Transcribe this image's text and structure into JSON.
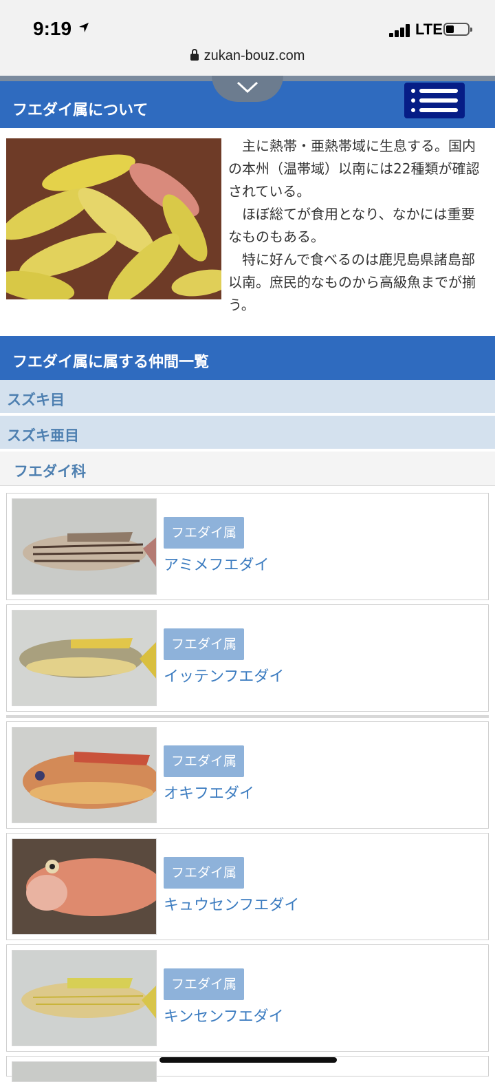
{
  "status_bar": {
    "time": "9:19",
    "network": "LTE",
    "url": "zukan-bouz.com"
  },
  "header": {
    "title": "フエダイ属について"
  },
  "intro": {
    "paragraphs": [
      "主に熱帯・亜熱帯域に生息する。国内の本州（温帯域）以南には22種類が確認されている。",
      "ほぼ総てが食用となり、なかには重要なものもある。",
      "特に好んで食べるのは鹿児島県諸島部以南。庶民的なものから高級魚までが揃う。"
    ]
  },
  "list_header": {
    "title": "フエダイ属に属する仲間一覧"
  },
  "taxonomy": {
    "order": "スズキ目",
    "suborder": "スズキ亜目",
    "family": "フエダイ科"
  },
  "species": [
    {
      "genus": "フエダイ属",
      "name": "アミメフエダイ"
    },
    {
      "genus": "フエダイ属",
      "name": "イッテンフエダイ"
    },
    {
      "genus": "フエダイ属",
      "name": "オキフエダイ"
    },
    {
      "genus": "フエダイ属",
      "name": "キュウセンフエダイ"
    },
    {
      "genus": "フエダイ属",
      "name": "キンセンフエダイ"
    }
  ],
  "colors": {
    "header_blue": "#2f6bbf",
    "menu_navy": "#061d86",
    "badge": "#8eb2da",
    "link": "#3c7cc0",
    "taxonomy_bg": "#d4e1ee"
  }
}
